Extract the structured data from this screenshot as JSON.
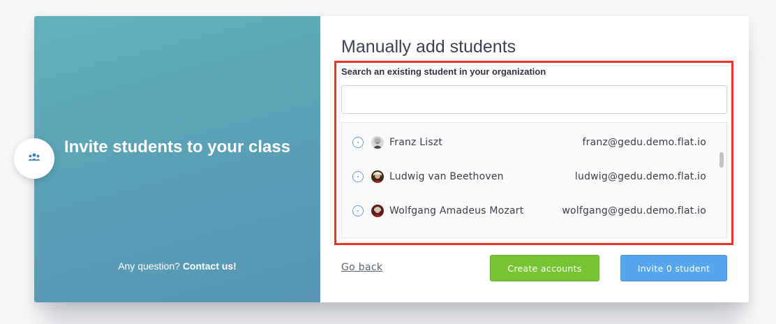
{
  "left_panel": {
    "title": "Invite students to your class",
    "question_prefix": "Any question? ",
    "contact_link": "Contact us!",
    "badge_icon": "people-group-icon"
  },
  "main": {
    "title": "Manually add students",
    "search": {
      "label": "Search an existing student in your organization",
      "value": "",
      "placeholder": ""
    },
    "students": [
      {
        "name": "Franz Liszt",
        "email": "franz@gedu.demo.flat.io",
        "selected": false,
        "avatar": "portrait-liszt"
      },
      {
        "name": "Ludwig van Beethoven",
        "email": "ludwig@gedu.demo.flat.io",
        "selected": false,
        "avatar": "portrait-beethoven"
      },
      {
        "name": "Wolfgang Amadeus Mozart",
        "email": "wolfgang@gedu.demo.flat.io",
        "selected": false,
        "avatar": "portrait-mozart"
      }
    ],
    "actions": {
      "go_back": "Go back",
      "create_accounts": "Create accounts",
      "invite": "Invite 0 student"
    }
  },
  "colors": {
    "highlight": "#e8342a",
    "green_button": "#77c432",
    "blue_button": "#56a6ee",
    "panel_gradient_start": "#62b2b8",
    "panel_gradient_end": "#5896b4"
  }
}
